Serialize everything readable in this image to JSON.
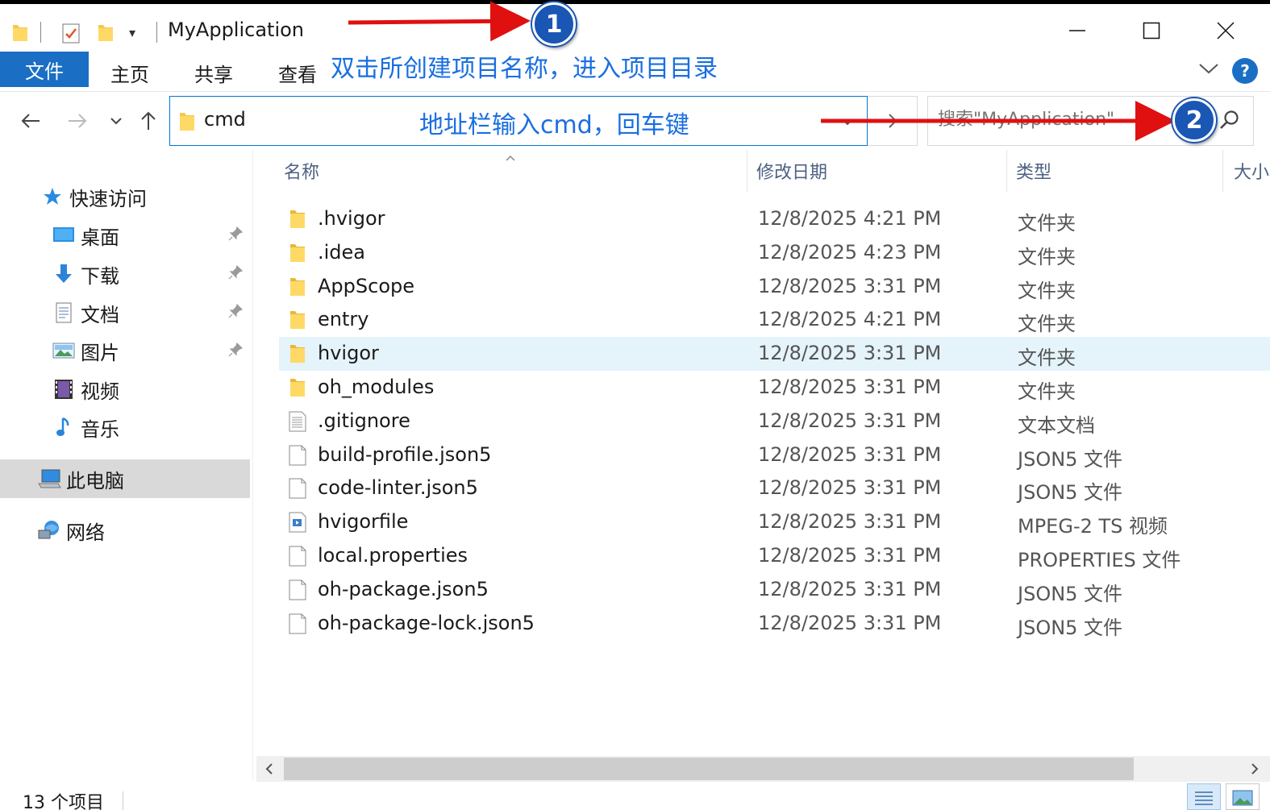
{
  "window": {
    "title": "MyApplication"
  },
  "ribbon": {
    "tabs": [
      {
        "label": "文件"
      },
      {
        "label": "主页"
      },
      {
        "label": "共享"
      },
      {
        "label": "查看"
      }
    ],
    "help_label": "?"
  },
  "address": {
    "value": "cmd"
  },
  "search": {
    "placeholder": "搜索\"MyApplication\""
  },
  "columns": {
    "name": "名称",
    "date": "修改日期",
    "type": "类型",
    "size": "大小"
  },
  "sidebar": {
    "quick_access": "快速访问",
    "items": [
      {
        "label": "桌面",
        "icon": "desktop-icon",
        "pinned": true
      },
      {
        "label": "下载",
        "icon": "download-icon",
        "pinned": true
      },
      {
        "label": "文档",
        "icon": "document-icon",
        "pinned": true
      },
      {
        "label": "图片",
        "icon": "picture-icon",
        "pinned": true
      },
      {
        "label": "视频",
        "icon": "video-icon",
        "pinned": false
      },
      {
        "label": "音乐",
        "icon": "music-icon",
        "pinned": false
      }
    ],
    "this_pc": "此电脑",
    "network": "网络"
  },
  "files": [
    {
      "name": ".hvigor",
      "date": "12/8/2025 4:21 PM",
      "type": "文件夹",
      "icon": "folder-icon",
      "selected": false
    },
    {
      "name": ".idea",
      "date": "12/8/2025 4:23 PM",
      "type": "文件夹",
      "icon": "folder-icon",
      "selected": false
    },
    {
      "name": "AppScope",
      "date": "12/8/2025 3:31 PM",
      "type": "文件夹",
      "icon": "folder-icon",
      "selected": false
    },
    {
      "name": "entry",
      "date": "12/8/2025 4:21 PM",
      "type": "文件夹",
      "icon": "folder-icon",
      "selected": false
    },
    {
      "name": "hvigor",
      "date": "12/8/2025 3:31 PM",
      "type": "文件夹",
      "icon": "folder-icon",
      "selected": true
    },
    {
      "name": "oh_modules",
      "date": "12/8/2025 3:31 PM",
      "type": "文件夹",
      "icon": "folder-icon",
      "selected": false
    },
    {
      "name": ".gitignore",
      "date": "12/8/2025 3:31 PM",
      "type": "文本文档",
      "icon": "text-file-icon",
      "selected": false
    },
    {
      "name": "build-profile.json5",
      "date": "12/8/2025 3:31 PM",
      "type": "JSON5 文件",
      "icon": "file-icon",
      "selected": false
    },
    {
      "name": "code-linter.json5",
      "date": "12/8/2025 3:31 PM",
      "type": "JSON5 文件",
      "icon": "file-icon",
      "selected": false
    },
    {
      "name": "hvigorfile",
      "date": "12/8/2025 3:31 PM",
      "type": "MPEG-2 TS 视频",
      "icon": "video-file-icon",
      "selected": false
    },
    {
      "name": "local.properties",
      "date": "12/8/2025 3:31 PM",
      "type": "PROPERTIES 文件",
      "icon": "file-icon",
      "selected": false
    },
    {
      "name": "oh-package.json5",
      "date": "12/8/2025 3:31 PM",
      "type": "JSON5 文件",
      "icon": "file-icon",
      "selected": false
    },
    {
      "name": "oh-package-lock.json5",
      "date": "12/8/2025 3:31 PM",
      "type": "JSON5 文件",
      "icon": "file-icon",
      "selected": false
    }
  ],
  "status": {
    "count": "13 个项目"
  },
  "annotations": {
    "step1_number": "1",
    "step1_text": "双击所创建项目名称，进入项目目录",
    "step2_number": "2",
    "step2_text": "地址栏输入cmd，回车键"
  },
  "colors": {
    "accent": "#1a6fc4",
    "selection": "#e5f3fb",
    "annotation_text": "#1a6fe0",
    "annotation_arrow": "#e01010"
  }
}
